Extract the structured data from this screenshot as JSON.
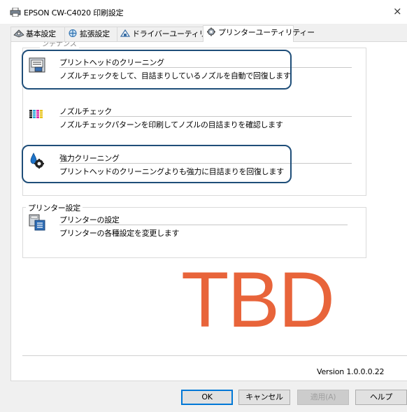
{
  "window": {
    "title": "EPSON CW-C4020 印刷設定",
    "close_glyph": "×",
    "printer_icon": "printer-icon"
  },
  "tabs": [
    {
      "label": "基本設定",
      "icon": "basic-settings-icon",
      "active": false
    },
    {
      "label": "拡張設定",
      "icon": "extended-settings-icon",
      "active": false
    },
    {
      "label": "ドライバーユーティリティー",
      "icon": "driver-utility-icon",
      "active": false
    },
    {
      "label": "プリンターユーティリティー",
      "icon": "printer-utility-icon",
      "active": true
    }
  ],
  "maintenance_group": {
    "items": [
      {
        "name": "プリントヘッドのクリーニング",
        "description": "ノズルチェックをして、目詰まりしているノズルを自動で回復します",
        "icon": "head-cleaning-icon",
        "highlighted": true
      },
      {
        "name": "ノズルチェック",
        "description": "ノズルチェックパターンを印刷してノズルの目詰まりを確認します",
        "icon": "nozzle-check-icon",
        "highlighted": false
      },
      {
        "name": "強力クリーニング",
        "description": "プリントヘッドのクリーニングよりも強力に目詰まりを回復します",
        "icon": "power-cleaning-icon",
        "highlighted": true
      }
    ]
  },
  "printer_settings_group": {
    "legend": "プリンター設定",
    "items": [
      {
        "name": "プリンターの設定",
        "description": "プリンターの各種設定を変更します",
        "icon": "printer-settings-icon"
      }
    ]
  },
  "overlay_text": "TBD",
  "version": "Version 1.0.0.0.22",
  "buttons": {
    "ok": "OK",
    "cancel": "キャンセル",
    "apply": "適用(A)",
    "help": "ヘルプ"
  },
  "colors": {
    "highlight": "#1f4e79",
    "tbd": "#e8643a",
    "ok_border": "#0078d7"
  }
}
